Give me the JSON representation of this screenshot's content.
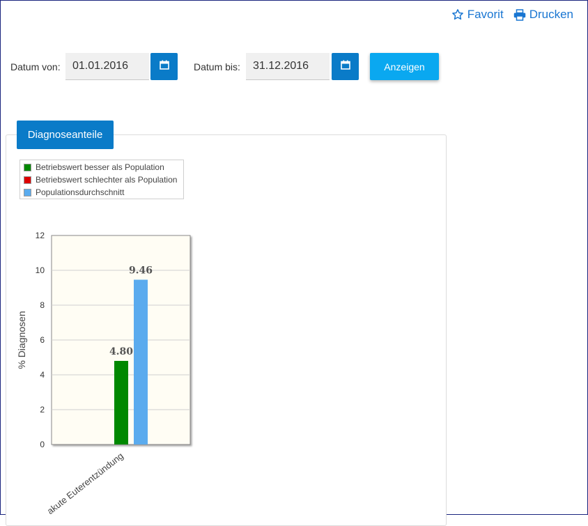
{
  "toolbar": {
    "favorite_label": "Favorit",
    "print_label": "Drucken"
  },
  "filters": {
    "from_label": "Datum von:",
    "from_value": "01.01.2016",
    "to_label": "Datum bis:",
    "to_value": "31.12.2016",
    "show_label": "Anzeigen"
  },
  "panel": {
    "tab_label": "Diagnoseanteile"
  },
  "colors": {
    "accent": "#0a7bc8",
    "button": "#0aa8f0",
    "better": "#008800",
    "worse": "#dd0000",
    "population": "#5aabee",
    "plot_bg": "#fffdf4"
  },
  "chart_data": {
    "type": "bar",
    "categories": [
      "akute Euterentzündung"
    ],
    "series": [
      {
        "name": "Betriebswert besser als Population",
        "color": "#008800",
        "values": [
          4.8
        ]
      },
      {
        "name": "Populationsdurchschnitt",
        "color": "#5aabee",
        "values": [
          9.46
        ]
      }
    ],
    "legend": [
      {
        "name": "Betriebswert besser als Population",
        "color": "#008800"
      },
      {
        "name": "Betriebswert schlechter als Population",
        "color": "#dd0000"
      },
      {
        "name": "Populationsdurchschnitt",
        "color": "#5aabee"
      }
    ],
    "data_labels": [
      "4.80",
      "9.46"
    ],
    "ylabel": "% Diagnosen",
    "xlabel": "",
    "ylim": [
      0,
      12
    ],
    "yticks": [
      0,
      2,
      4,
      6,
      8,
      10,
      12
    ],
    "grid": true,
    "legend_position": "top-left"
  }
}
